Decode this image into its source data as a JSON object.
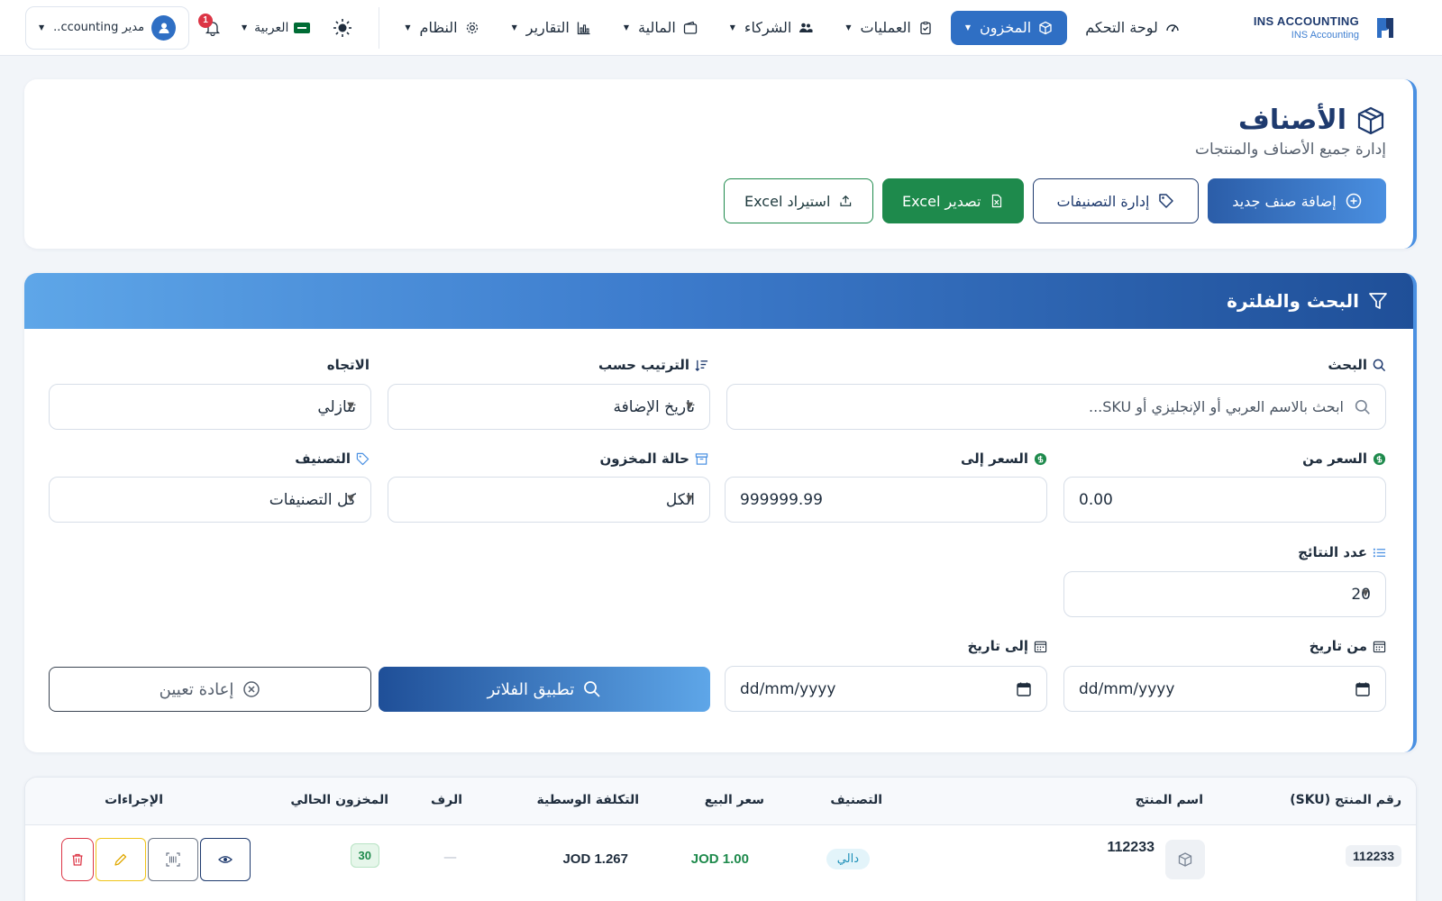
{
  "brand": {
    "name": "INS ACCOUNTING",
    "sub": "INS Accounting",
    "logo_icon": "appoint-logo-icon"
  },
  "nav": {
    "items": [
      {
        "label": "لوحة التحكم",
        "icon": "dashboard-gauge-icon",
        "active": false,
        "has_caret": false
      },
      {
        "label": "المخزون",
        "icon": "box-icon",
        "active": true,
        "has_caret": true
      },
      {
        "label": "العمليات",
        "icon": "clipboard-check-icon",
        "active": false,
        "has_caret": true
      },
      {
        "label": "الشركاء",
        "icon": "people-icon",
        "active": false,
        "has_caret": true
      },
      {
        "label": "المالية",
        "icon": "wallet-icon",
        "active": false,
        "has_caret": true
      },
      {
        "label": "التقارير",
        "icon": "bar-chart-icon",
        "active": false,
        "has_caret": true
      },
      {
        "label": "النظام",
        "icon": "gear-icon",
        "active": false,
        "has_caret": true
      }
    ],
    "language": "العربية",
    "notifications_count": "1",
    "user_label": "مدير ccounting..."
  },
  "header": {
    "title": "الأصناف",
    "subtitle": "إدارة جميع الأصناف والمنتجات",
    "actions": {
      "add": "إضافة صنف جديد",
      "manage_categories": "إدارة التصنيفات",
      "export": "تصدير Excel",
      "import": "استيراد Excel"
    }
  },
  "filters": {
    "title": "البحث والفلترة",
    "search_label": "البحث",
    "search_placeholder": "ابحث بالاسم العربي أو الإنجليزي أو SKU...",
    "sort_label": "الترتيب حسب",
    "sort_value": "تاريخ الإضافة",
    "direction_label": "الاتجاه",
    "direction_value": "تنازلي",
    "price_from_label": "السعر من",
    "price_from_value": "0.00",
    "price_to_label": "السعر إلى",
    "price_to_value": "999999.99",
    "stock_status_label": "حالة المخزون",
    "stock_status_value": "الكل",
    "category_label": "التصنيف",
    "category_value": "كل التصنيفات",
    "results_label": "عدد النتائج",
    "results_value": "20",
    "date_from_label": "من تاريخ",
    "date_from_placeholder": "dd/mm/yyyy",
    "date_to_label": "إلى تاريخ",
    "date_to_placeholder": "dd/mm/yyyy",
    "apply": "تطبيق الفلاتر",
    "reset": "إعادة تعيين"
  },
  "table": {
    "headers": {
      "sku": "رقم المنتج (SKU)",
      "name": "اسم المنتج",
      "category": "التصنيف",
      "price": "سعر البيع",
      "avg_cost": "التكلفة الوسطية",
      "shelf": "الرف",
      "stock": "المخزون الحالي",
      "actions": "الإجراءات"
    },
    "rows": [
      {
        "sku": "112233",
        "name": "112233",
        "category": "دالي",
        "price": "1.00 JOD",
        "avg_cost": "1.267 JOD",
        "shelf": "—",
        "stock": "30"
      }
    ]
  },
  "colors": {
    "primary": "#2f6fc4",
    "navy": "#1e3a6e",
    "green": "#1e8a4c",
    "danger": "#dc3545",
    "warning": "#f0c419"
  }
}
